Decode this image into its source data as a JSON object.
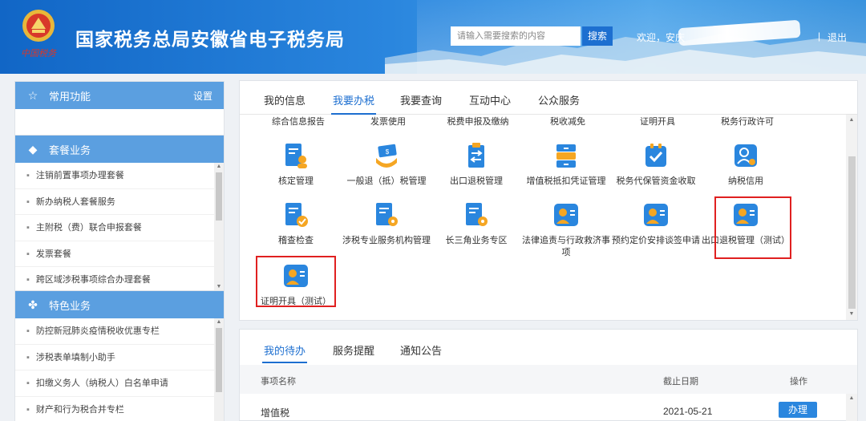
{
  "header": {
    "title": "国家税务总局安徽省电子税务局",
    "search_placeholder": "请输入需要搜索的内容",
    "search_button": "搜索",
    "welcome": "欢迎，安庆",
    "separator": "|",
    "logout": "退出"
  },
  "sidebar": {
    "common": {
      "title": "常用功能",
      "settings": "设置"
    },
    "package": {
      "title": "套餐业务",
      "items": [
        "注销前置事项办理套餐",
        "新办纳税人套餐服务",
        "主附税（费）联合申报套餐",
        "发票套餐",
        "跨区域涉税事项综合办理套餐"
      ]
    },
    "special": {
      "title": "特色业务",
      "items": [
        "防控新冠肺炎疫情税收优惠专栏",
        "涉税表单填制小助手",
        "扣缴义务人（纳税人）白名单申请",
        "财产和行为税合并专栏"
      ]
    }
  },
  "main": {
    "tabs": [
      "我的信息",
      "我要办税",
      "我要查询",
      "互动中心",
      "公众服务"
    ],
    "active_tab": "我要办税",
    "sub_categories": [
      "综合信息报告",
      "发票使用",
      "税费申报及缴纳",
      "税收减免",
      "证明开具",
      "税务行政许可"
    ],
    "functions_row1": [
      "核定管理",
      "一般退（抵）税管理",
      "出口退税管理",
      "增值税抵扣凭证管理",
      "税务代保管资金收取",
      "纳税信用"
    ],
    "functions_row2": [
      "稽查检查",
      "涉税专业服务机构管理",
      "长三角业务专区",
      "法律追责与行政救济事项",
      "预约定价安排谈签申请",
      "出口退税管理（测试）"
    ],
    "functions_row3": [
      "证明开具（测试）"
    ]
  },
  "todo": {
    "tabs": [
      "我的待办",
      "服务提醒",
      "通知公告"
    ],
    "columns": [
      "事项名称",
      "截止日期",
      "操作"
    ],
    "rows": [
      {
        "name": "增值税",
        "deadline": "2021-05-21",
        "action": "办理"
      }
    ]
  },
  "colors": {
    "header_blue": "#1166c6",
    "accent_blue": "#1d6fd0",
    "panel_head": "#5b9fe0",
    "icon_blue": "#2a86de",
    "icon_orange": "#f5a623",
    "highlight_red": "#e02020"
  }
}
